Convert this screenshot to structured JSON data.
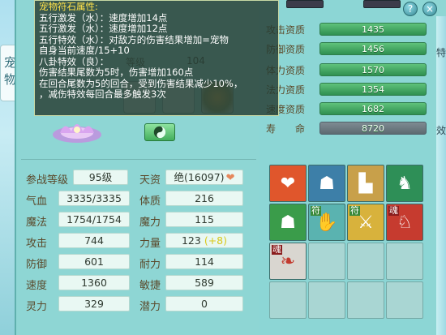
{
  "side_tab": {
    "label": "宠物"
  },
  "window_buttons": {
    "help_label": "?",
    "close_label": "×"
  },
  "tooltip": {
    "title": "宠物符石属性:",
    "lines": [
      "五行激发（水）：速度增加14点",
      "五行激发（水）：速度增加12点",
      "五行特效（水）：对敌方的伤害结果增加=宠物",
      "自身当前速度/15+10",
      "八卦特效（良）：",
      "伤害结果尾数为5时，伤害增加160点",
      "在回合尾数为5的回合，受到伤害结果减少10%，",
      "，减伤特效每回合最多触发3次"
    ]
  },
  "behind": {
    "level_label": "等级",
    "level_value": "104"
  },
  "pet_stats": [
    {
      "label": "攻击资质",
      "value": "1435"
    },
    {
      "label": "防御资质",
      "value": "1456"
    },
    {
      "label": "体力资质",
      "value": "1570"
    },
    {
      "label": "法力资质",
      "value": "1354"
    },
    {
      "label": "速度资质",
      "value": "1682"
    }
  ],
  "lifespan": {
    "label_a": "寿",
    "label_b": "命",
    "value": "8720"
  },
  "attributes": {
    "join_level": {
      "label": "参战等级",
      "value": "95级"
    },
    "talent": {
      "label": "天资",
      "value": "绝(16097)",
      "icon": "heart-icon"
    },
    "hp": {
      "label": "气血",
      "value": "3335/3335"
    },
    "constitution": {
      "label": "体质",
      "value": "216"
    },
    "mana": {
      "label": "魔法",
      "value": "1754/1754"
    },
    "magic": {
      "label": "魔力",
      "value": "115"
    },
    "attack": {
      "label": "攻击",
      "value": "744"
    },
    "strength": {
      "label": "力量",
      "value": "123",
      "bonus": "(+8)"
    },
    "defense": {
      "label": "防御",
      "value": "601"
    },
    "endurance": {
      "label": "耐力",
      "value": "114"
    },
    "speed": {
      "label": "速度",
      "value": "1360"
    },
    "agility": {
      "label": "敏捷",
      "value": "589"
    },
    "spirit": {
      "label": "灵力",
      "value": "329"
    },
    "potential": {
      "label": "潜力",
      "value": "0"
    }
  },
  "skills": [
    {
      "icon": "heart-shield-skill-icon",
      "glyph": "❤",
      "bg": "#e0562c",
      "tag": ""
    },
    {
      "icon": "blue-figure-skill-icon",
      "glyph": "☗",
      "bg": "#3d7fa8",
      "tag": ""
    },
    {
      "icon": "boot-skill-icon",
      "glyph": "👢",
      "bg": "#c8a04a",
      "tag": ""
    },
    {
      "icon": "deer-skill-icon",
      "glyph": "♞",
      "bg": "#2e8f57",
      "tag": ""
    },
    {
      "icon": "green-giant-skill-icon",
      "glyph": "☗",
      "bg": "#3a9c4a",
      "tag": ""
    },
    {
      "icon": "talisman-hand-skill-icon",
      "glyph": "✋",
      "bg": "#5ab3b0",
      "tag": "符"
    },
    {
      "icon": "talisman-blade-skill-icon",
      "glyph": "⚔",
      "bg": "#d8b23c",
      "tag": "符"
    },
    {
      "icon": "beast-skill-icon",
      "glyph": "♘",
      "bg": "#c63b2f",
      "tag": "魂"
    },
    {
      "icon": "phoenix-skill-icon",
      "glyph": "❧",
      "bg": "#d9d6d0",
      "tag": "魂"
    }
  ],
  "edge_text": {
    "right_top": "特",
    "right_bottom": "效"
  }
}
